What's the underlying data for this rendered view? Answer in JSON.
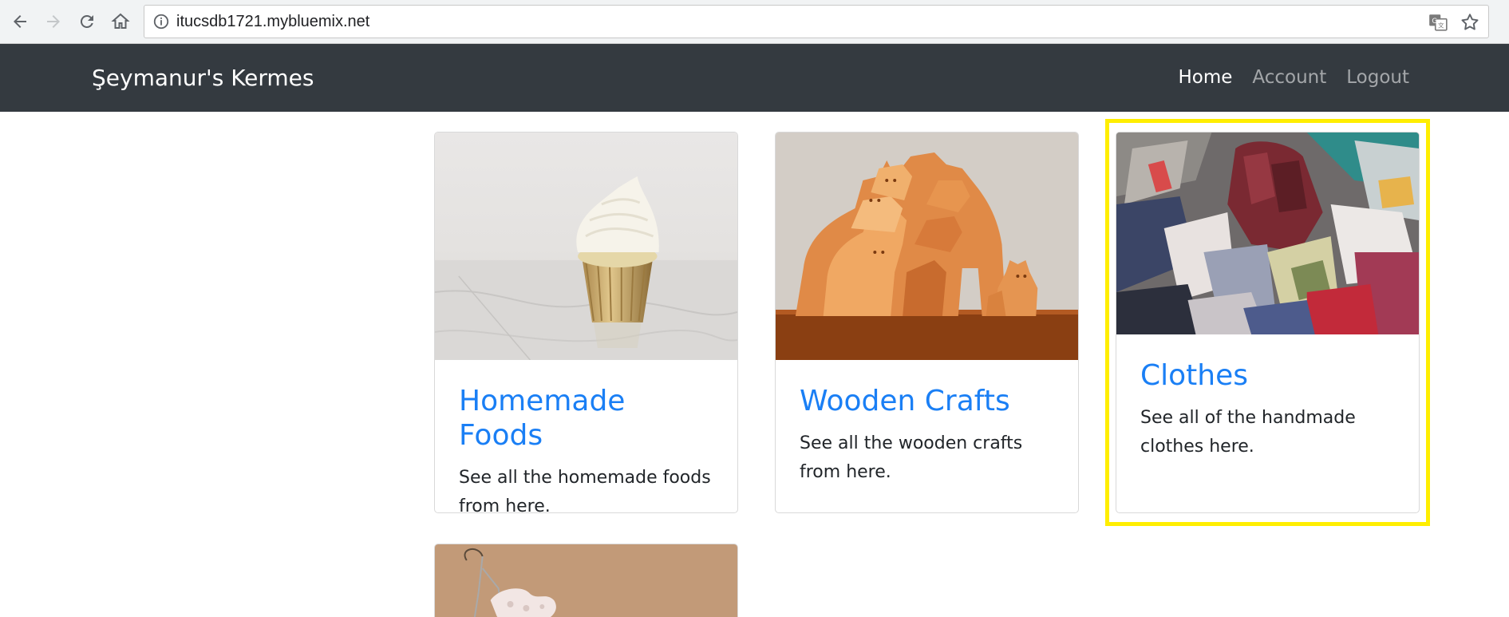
{
  "browser": {
    "url": "itucsdb1721.mybluemix.net",
    "icons": [
      "back-arrow-icon",
      "forward-arrow-icon",
      "reload-icon",
      "home-icon",
      "info-icon",
      "translate-icon",
      "star-icon"
    ]
  },
  "navbar": {
    "brand": "Şeymanur's Kermes",
    "links": [
      {
        "label": "Home",
        "active": true
      },
      {
        "label": "Account",
        "active": false
      },
      {
        "label": "Logout",
        "active": false
      }
    ]
  },
  "cards": [
    {
      "title": "Homemade Foods",
      "text": "See all the homemade foods from here.",
      "image": "cupcake"
    },
    {
      "title": "Wooden Crafts",
      "text": "See all the wooden crafts from here.",
      "image": "wooden-cat-puzzle"
    },
    {
      "title": "Clothes",
      "text": "See all of the handmade clothes here.",
      "image": "pile-of-clothes"
    },
    {
      "title": "",
      "text": "",
      "image": "lace-earring"
    }
  ],
  "colors": {
    "navbar_bg": "#343a40",
    "link": "#1a7ff5",
    "highlight": "#ffee00"
  }
}
